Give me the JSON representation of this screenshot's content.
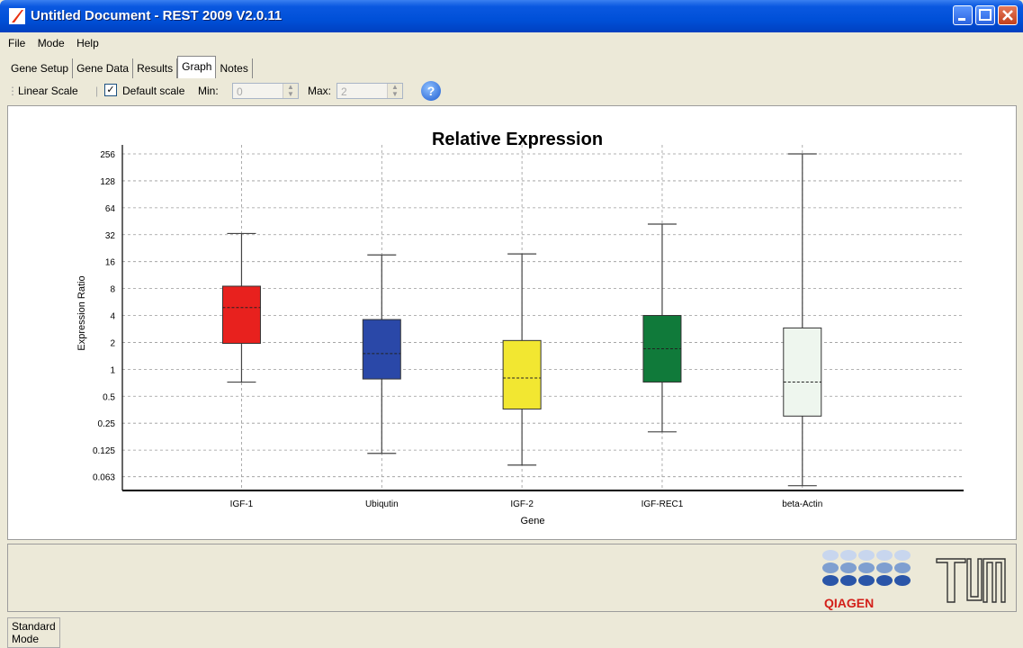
{
  "window": {
    "title": "Untitled Document - REST 2009 V2.0.11"
  },
  "menu": [
    "File",
    "Mode",
    "Help"
  ],
  "tabs": [
    {
      "label": "Gene Setup",
      "active": false
    },
    {
      "label": "Gene Data",
      "active": false
    },
    {
      "label": "Results",
      "active": false
    },
    {
      "label": "Graph",
      "active": true
    },
    {
      "label": "Notes",
      "active": false
    }
  ],
  "toolbar": {
    "linear_scale": "Linear Scale",
    "default_scale": "Default scale",
    "default_scale_checked": true,
    "min_label": "Min:",
    "min_value": "0",
    "max_label": "Max:",
    "max_value": "2",
    "help": "?"
  },
  "chart_data": {
    "type": "boxplot",
    "title": "Relative Expression",
    "xlabel": "Gene",
    "ylabel": "Expression Ratio",
    "y_scale": "log2",
    "y_ticks": [
      "256",
      "128",
      "64",
      "32",
      "16",
      "8",
      "4",
      "2",
      "1",
      "0.5",
      "0.25",
      "0.125",
      "0.063"
    ],
    "grid": true,
    "boxes": [
      {
        "name": "IGF-1",
        "color": "#e8211e",
        "whisker_low": 0.72,
        "q1": 1.95,
        "median": 4.9,
        "q3": 8.5,
        "whisker_high": 33
      },
      {
        "name": "Ubiqutin",
        "color": "#2a48a8",
        "whisker_low": 0.115,
        "q1": 0.78,
        "median": 1.5,
        "q3": 3.6,
        "whisker_high": 19
      },
      {
        "name": "IGF-2",
        "color": "#f2e731",
        "whisker_low": 0.085,
        "q1": 0.36,
        "median": 0.8,
        "q3": 2.1,
        "whisker_high": 19.5
      },
      {
        "name": "IGF-REC1",
        "color": "#107a3a",
        "whisker_low": 0.2,
        "q1": 0.72,
        "median": 1.7,
        "q3": 4.0,
        "whisker_high": 42
      },
      {
        "name": "beta-Actin",
        "color": "#eef6ee",
        "whisker_low": 0.05,
        "q1": 0.3,
        "median": 0.72,
        "q3": 2.9,
        "whisker_high": 256
      }
    ]
  },
  "status": {
    "mode": "Standard Mode"
  },
  "logos": {
    "qiagen": "QIAGEN",
    "tum": "TUM"
  }
}
